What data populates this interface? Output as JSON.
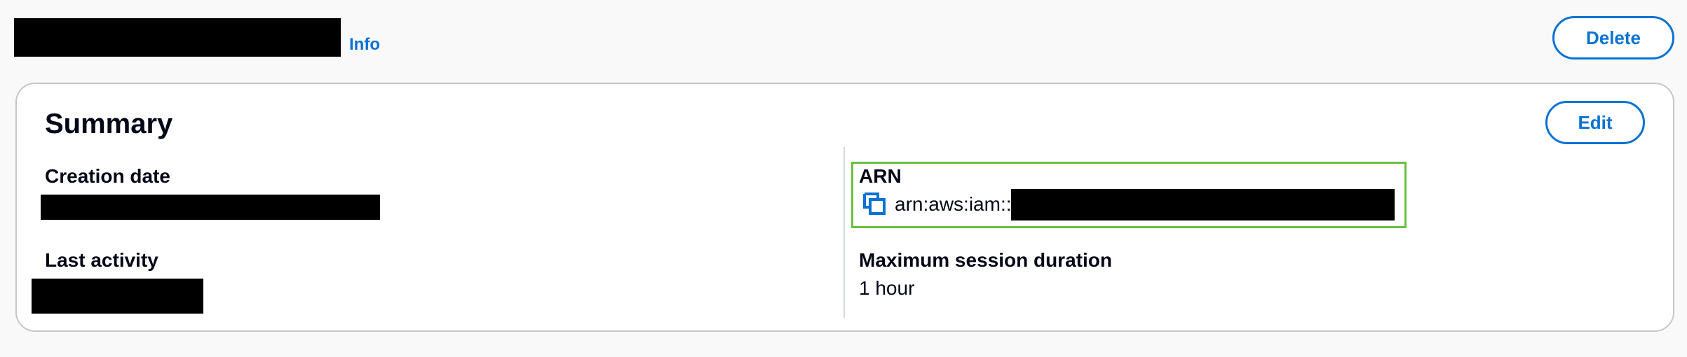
{
  "header": {
    "info_link": "Info",
    "delete_label": "Delete"
  },
  "summary": {
    "title": "Summary",
    "edit_label": "Edit",
    "creation_date_label": "Creation date",
    "last_activity_label": "Last activity",
    "arn_label": "ARN",
    "arn_prefix": "arn:aws:iam::",
    "max_session_label": "Maximum session duration",
    "max_session_value": "1 hour"
  },
  "icons": {
    "copy": "copy-icon",
    "warning": "warning-icon"
  },
  "colors": {
    "link": "#0972d3",
    "highlight_border": "#6abf40",
    "warning": "#d45b07"
  }
}
